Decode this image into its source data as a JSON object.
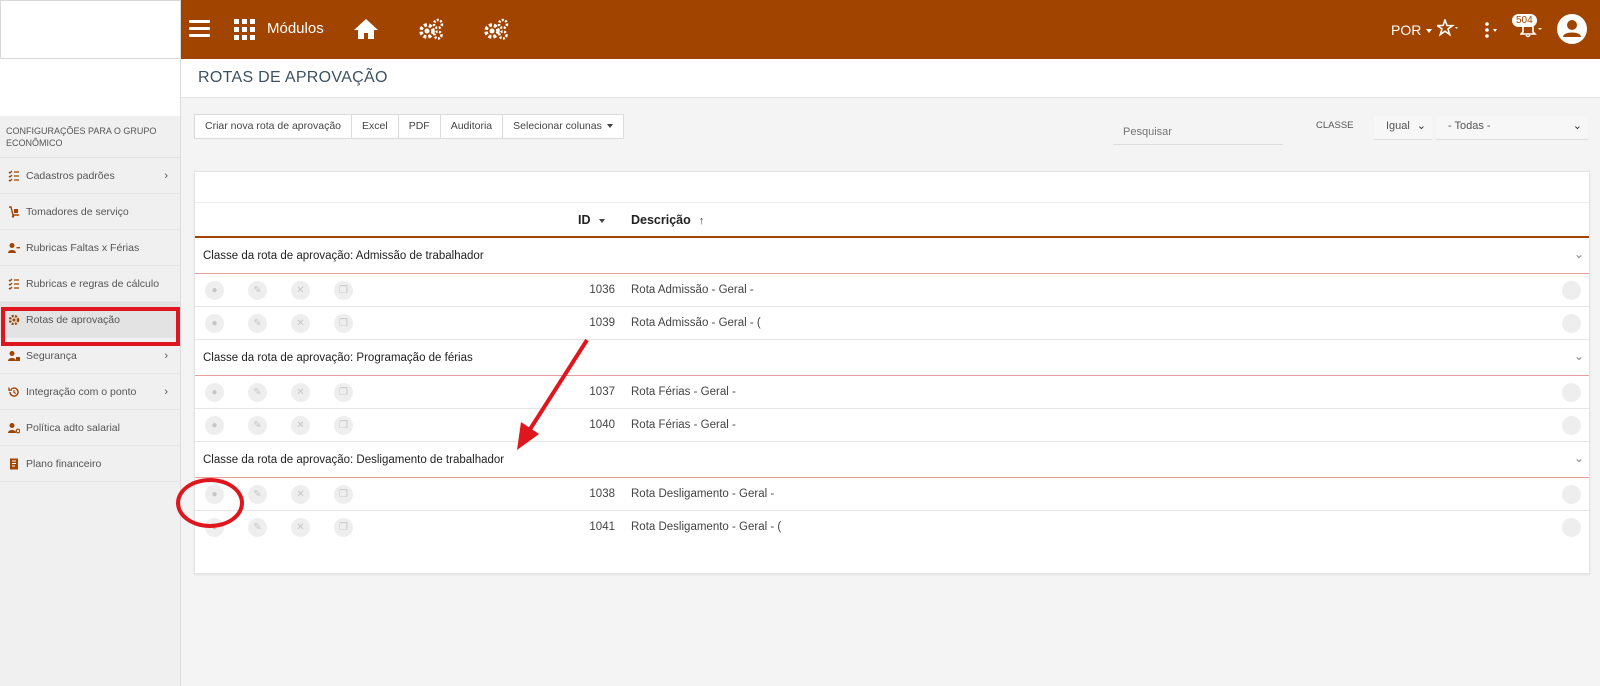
{
  "topbar": {
    "modules_label": "Módulos",
    "language": "POR",
    "notification_count": "504"
  },
  "sidebar": {
    "group_title": "CONFIGURAÇÕES PARA O GRUPO ECONÔMICO",
    "items": [
      {
        "label": "Cadastros padrões",
        "has_submenu": true
      },
      {
        "label": "Tomadores de serviço",
        "has_submenu": false
      },
      {
        "label": "Rubricas Faltas x Férias",
        "has_submenu": false
      },
      {
        "label": "Rubricas e regras de cálculo",
        "has_submenu": false
      },
      {
        "label": "Rotas de aprovação",
        "has_submenu": false,
        "active": true
      },
      {
        "label": "Segurança",
        "has_submenu": true
      },
      {
        "label": "Integração com o ponto",
        "has_submenu": true
      },
      {
        "label": "Política adto salarial",
        "has_submenu": false
      },
      {
        "label": "Plano financeiro",
        "has_submenu": false
      }
    ]
  },
  "page": {
    "title": "ROTAS DE APROVAÇÃO"
  },
  "toolbar": {
    "create_label": "Criar nova rota de aprovação",
    "excel_label": "Excel",
    "pdf_label": "PDF",
    "audit_label": "Auditoria",
    "columns_label": "Selecionar colunas"
  },
  "filters": {
    "search_placeholder": "Pesquisar",
    "classe_label": "CLASSE",
    "operator_value": "Igual",
    "classe_value": "- Todas -"
  },
  "table": {
    "col_id": "ID",
    "col_desc": "Descrição",
    "groups": [
      {
        "label": "Classe da rota de aprovação: Admissão de trabalhador",
        "rows": [
          {
            "id": "1036",
            "desc": "Rota Admissão - Geral -"
          },
          {
            "id": "1039",
            "desc": "Rota Admissão - Geral - ("
          }
        ]
      },
      {
        "label": "Classe da rota de aprovação: Programação de férias",
        "rows": [
          {
            "id": "1037",
            "desc": "Rota Férias - Geral -"
          },
          {
            "id": "1040",
            "desc": "Rota Férias - Geral -"
          }
        ]
      },
      {
        "label": "Classe da rota de aprovação: Desligamento de trabalhador",
        "rows": [
          {
            "id": "1038",
            "desc": "Rota Desligamento - Geral -"
          },
          {
            "id": "1041",
            "desc": "Rota Desligamento - Geral - ("
          }
        ]
      }
    ]
  },
  "colors": {
    "brand": "#a04400",
    "annotation": "#e0161e"
  }
}
